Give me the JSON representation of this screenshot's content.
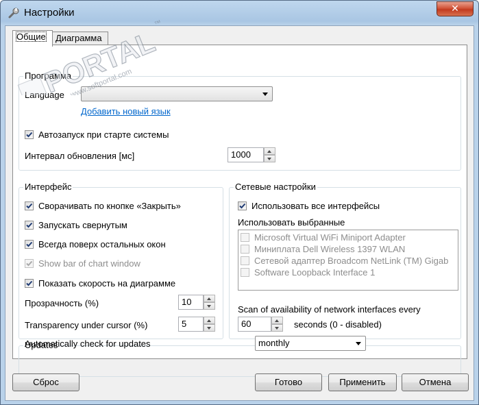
{
  "window": {
    "title": "Настройки",
    "close_glyph": "✕"
  },
  "tabs": [
    {
      "label": "Общие"
    },
    {
      "label": "Диаграмма"
    }
  ],
  "watermark": {
    "text": "PORTAL",
    "sub": "www.softportal.com",
    "tm": "™"
  },
  "program": {
    "title": "Программа",
    "language_label": "Language",
    "language_value": "",
    "add_language_link": "Добавить новый язык",
    "autostart_label": "Автозапуск при старте системы",
    "autostart_checked": true,
    "interval_label": "Интервал обновления [мс]",
    "interval_value": "1000"
  },
  "interface": {
    "title": "Интерфейс",
    "options": [
      {
        "label": "Сворачивать по кнопке «Закрыть»",
        "checked": true,
        "enabled": true
      },
      {
        "label": "Запускать свернутым",
        "checked": true,
        "enabled": true
      },
      {
        "label": "Всегда поверх остальных окон",
        "checked": true,
        "enabled": true
      },
      {
        "label": "Show bar of chart window",
        "checked": true,
        "enabled": false
      },
      {
        "label": "Показать скорость на диаграмме",
        "checked": true,
        "enabled": true
      }
    ],
    "opacity_label": "Прозрачность (%)",
    "opacity_value": "10",
    "cursor_opacity_label": "Transparency under cursor (%)",
    "cursor_opacity_value": "5"
  },
  "network": {
    "title": "Сетевые настройки",
    "use_all_label": "Использовать все интерфейсы",
    "use_all_checked": true,
    "use_selected_label": "Использовать выбранные",
    "adapters": [
      {
        "label": "Microsoft Virtual WiFi Miniport Adapter",
        "checked": false
      },
      {
        "label": "Миниплата Dell Wireless 1397 WLAN",
        "checked": false
      },
      {
        "label": "Сетевой адаптер Broadcom NetLink (TM) Gigab",
        "checked": false
      },
      {
        "label": "Software Loopback Interface 1",
        "checked": false
      }
    ],
    "scan_label": "Scan of availability of network interfaces every",
    "scan_value": "60",
    "scan_suffix": "seconds (0 - disabled)"
  },
  "updates": {
    "title": "Updates",
    "auto_check_label": "Automatically check for updates",
    "frequency_value": "monthly"
  },
  "buttons": {
    "reset": "Сброс",
    "ok": "Готово",
    "apply": "Применить",
    "cancel": "Отмена"
  }
}
